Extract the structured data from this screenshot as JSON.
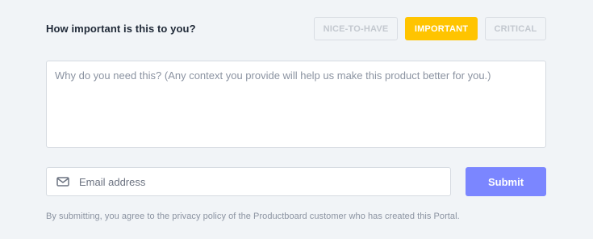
{
  "importance": {
    "question": "How important is this to you?",
    "options": [
      {
        "label": "NICE-TO-HAVE",
        "selected": false
      },
      {
        "label": "IMPORTANT",
        "selected": true
      },
      {
        "label": "CRITICAL",
        "selected": false
      }
    ],
    "colors": {
      "selected_bg": "#ffc400",
      "unselected_text": "#c3c8cf"
    }
  },
  "context": {
    "placeholder": "Why do you need this? (Any context you provide will help us make this product better for you.)",
    "value": ""
  },
  "email": {
    "icon": "mail-icon",
    "placeholder": "Email address",
    "value": ""
  },
  "submit": {
    "label": "Submit",
    "color": "#7b86ff"
  },
  "disclaimer": "By submitting, you agree to the privacy policy of the Productboard customer who has created this Portal."
}
